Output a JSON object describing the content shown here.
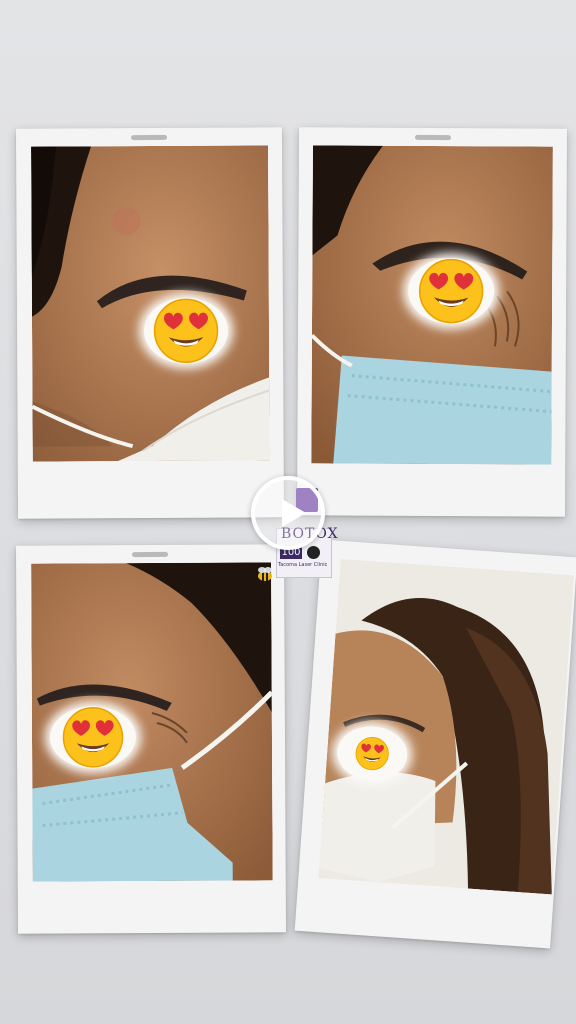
{
  "photos": [
    {
      "id": "before-left",
      "face_emoji": "smiling-face-with-heart-eyes"
    },
    {
      "id": "before-right",
      "face_emoji": "smiling-face-with-heart-eyes"
    },
    {
      "id": "after-left",
      "face_emoji": "smiling-face-with-heart-eyes"
    },
    {
      "id": "after-right",
      "face_emoji": "smiling-face-with-heart-eyes"
    }
  ],
  "badge": {
    "brand": "BOTOX",
    "units": "100",
    "clinic": "Tacoma Laser Clinic"
  },
  "icons": {
    "play": "play-icon",
    "bee": "bee-icon"
  },
  "colors": {
    "skin": "#b07e55",
    "hair": "#2b1a10",
    "mask_blue": "#a9d4e0",
    "mask_white": "#f1efea",
    "vial_purple": "#6b3fa0"
  }
}
